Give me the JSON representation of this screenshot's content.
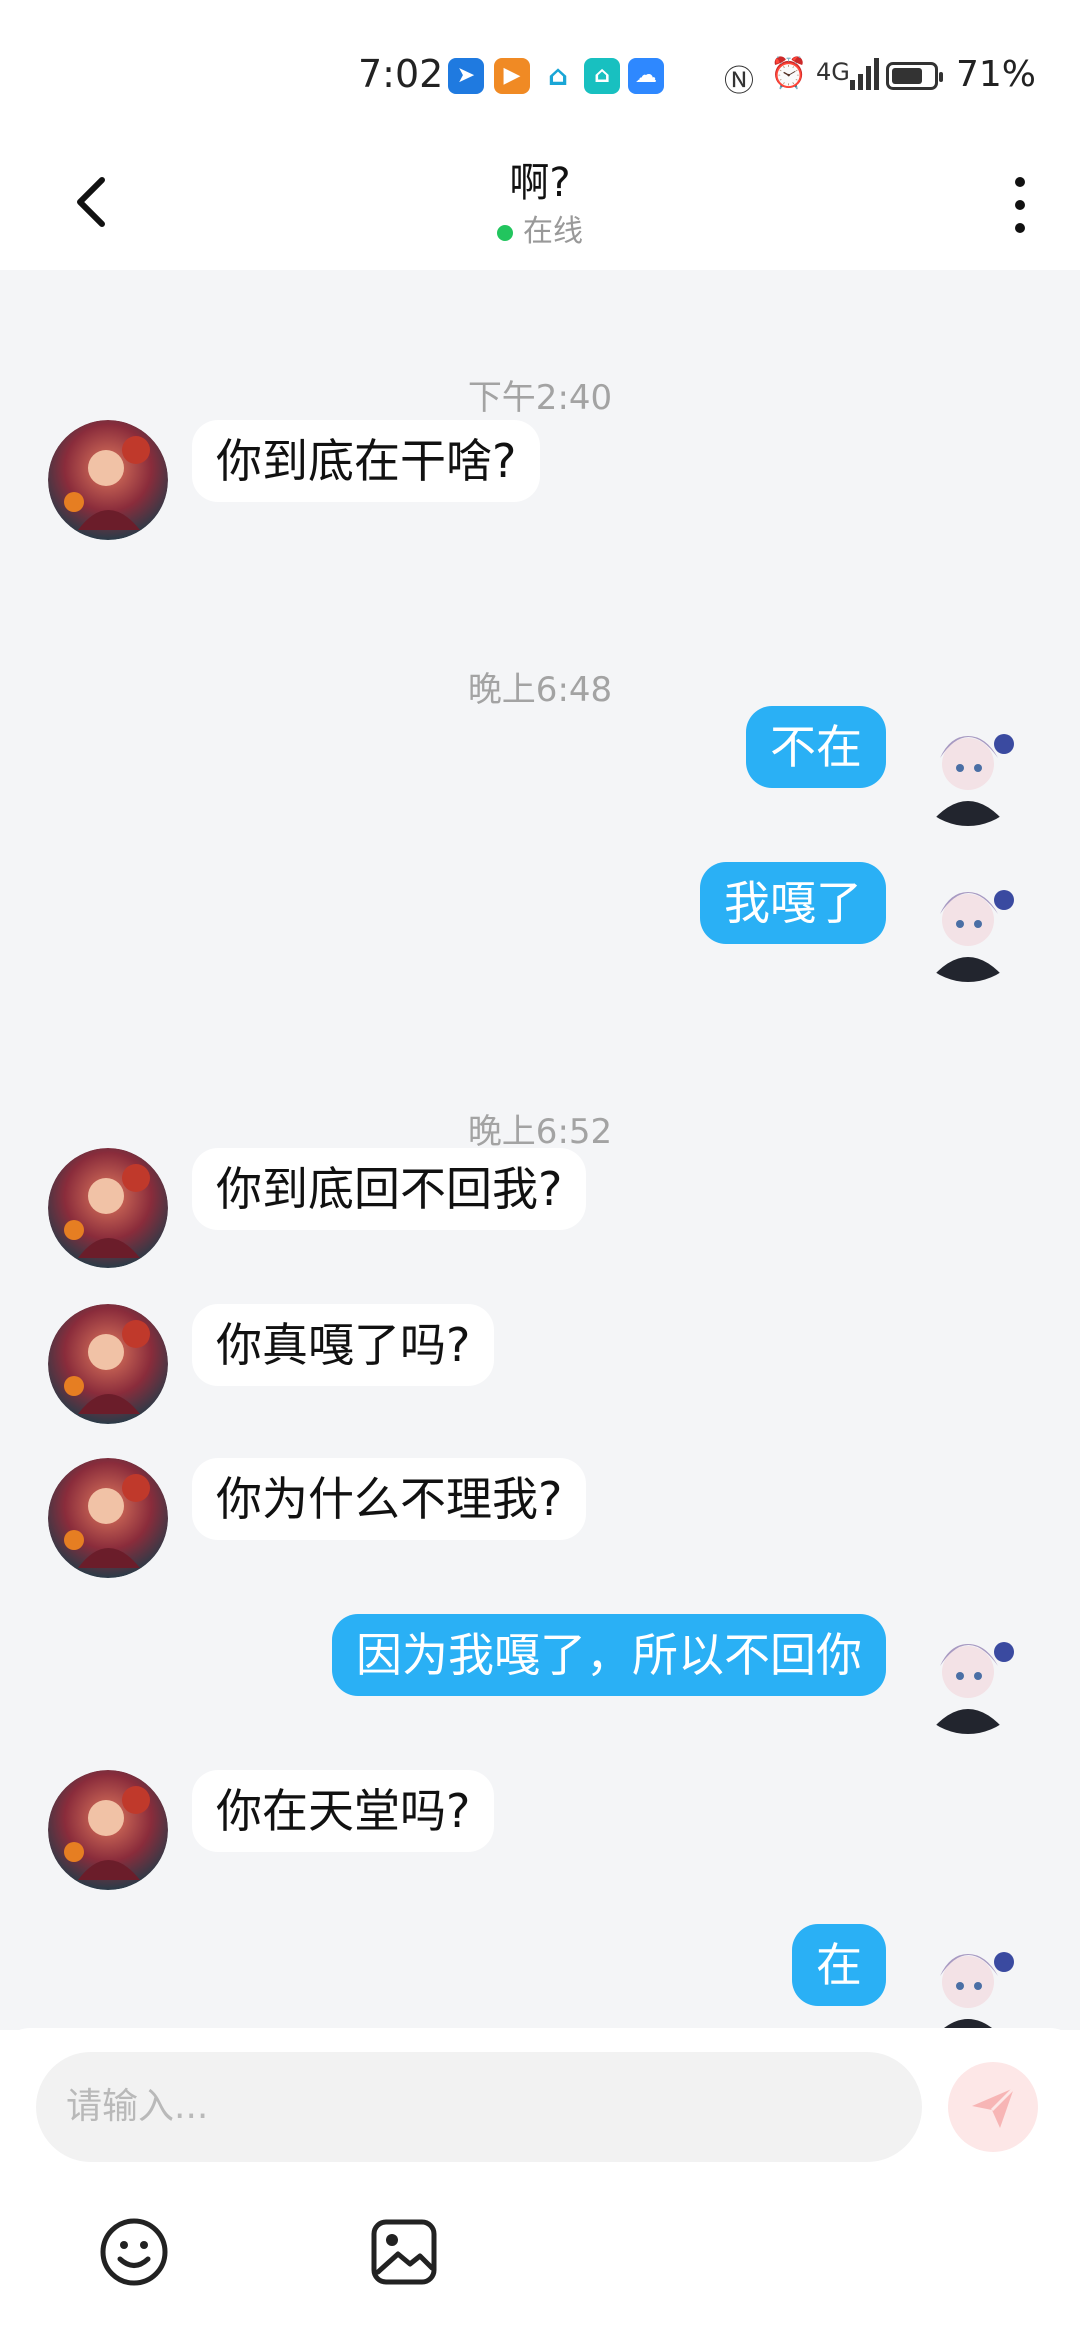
{
  "status_bar": {
    "time": "7:02",
    "battery_percent": "71%",
    "app_icons": [
      "direction-app-icon",
      "play-app-icon",
      "chat-app-icon",
      "home-app-icon",
      "cloud-app-icon"
    ],
    "right_icons": [
      "nfc-icon",
      "alarm-icon",
      "network-4g-icon",
      "signal-icon",
      "battery-icon"
    ]
  },
  "header": {
    "title": "啊?",
    "status": "在线",
    "back_icon": "chevron-left-icon",
    "menu_icon": "more-vertical-icon"
  },
  "chat": {
    "timestamps": [
      "下午2:40",
      "晚上6:48",
      "晚上6:52"
    ],
    "messages": [
      {
        "from": "them",
        "text": "你到底在干啥?"
      },
      {
        "from": "me",
        "text": "不在"
      },
      {
        "from": "me",
        "text": "我嘎了"
      },
      {
        "from": "them",
        "text": "你到底回不回我?"
      },
      {
        "from": "them",
        "text": "你真嘎了吗?"
      },
      {
        "from": "them",
        "text": "你为什么不理我?"
      },
      {
        "from": "me",
        "text": "因为我嘎了，所以不回你"
      },
      {
        "from": "them",
        "text": "你在天堂吗?"
      },
      {
        "from": "me",
        "text": "在"
      }
    ]
  },
  "composer": {
    "placeholder": "请输入...",
    "send_icon": "send-icon",
    "emoji_icon": "emoji-icon",
    "image_icon": "image-icon"
  },
  "colors": {
    "out_bubble": "#2ab0f5",
    "in_bubble": "#ffffff",
    "chat_bg": "#f4f5f7",
    "online": "#22c55e"
  }
}
